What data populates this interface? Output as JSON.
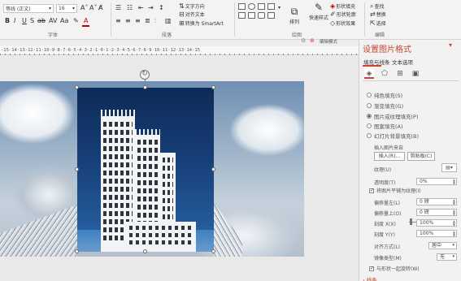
{
  "ribbon": {
    "font_name": "等线 (正文)",
    "font_size": "16",
    "group_labels": {
      "font": "字体",
      "paragraph": "段落",
      "drawing": "绘图",
      "editing": "编辑"
    },
    "text_direction": "文字方向",
    "align_text": "对齐文本",
    "convert_smartart": "转换为 SmartArt",
    "arrange": "排列",
    "quick_styles": "快速样式",
    "shape_fill": "形状填充",
    "shape_outline": "形状轮廓",
    "shape_effects": "形状效果",
    "find": "查找",
    "replace": "替换",
    "select": "选择",
    "editing_mode_label": "编辑模式"
  },
  "ruler": {
    "text": "-15·14·13·12·11·10·9·8·7·6·5·4·3·2·1·0·1·2·3·4·5·6·7·8·9·10·11·12·13·14·15"
  },
  "panel": {
    "title": "设置图片格式",
    "tab_fill_line": "填充与线条",
    "tab_text_box": "文本选项",
    "radio_options": [
      {
        "label": "纯色填充(S)",
        "checked": false
      },
      {
        "label": "渐变填充(G)",
        "checked": false
      },
      {
        "label": "图片或纹理填充(P)",
        "checked": true
      },
      {
        "label": "图案填充(A)",
        "checked": false
      },
      {
        "label": "幻灯片背景填充(B)",
        "checked": false
      }
    ],
    "insert_picture_from": "插入图片来自",
    "btn_file": "插入(R)...",
    "btn_clipboard": "剪贴板(C)",
    "texture_label": "纹理(U)",
    "transparency_label": "透明度(T)",
    "transparency_value": "0%",
    "tile_checkbox": "将图片平铺为纹理(I)",
    "offset_left_label": "偏移量左(L)",
    "offset_left_value": "0 磅",
    "offset_top_label": "偏移量上(O)",
    "offset_top_value": "0 磅",
    "scale_x_label": "刻度 X(X)",
    "scale_x_value": "100%",
    "scale_y_label": "刻度 Y(Y)",
    "scale_y_value": "100%",
    "alignment_label": "对齐方式(L)",
    "alignment_value": "居中",
    "mirror_label": "镜像类型(M)",
    "mirror_value": "无",
    "rotate_checkbox": "与形状一起旋转(W)",
    "line_section": "线条"
  },
  "colors": {
    "accent": "#c9452f",
    "photo_sky_top": "#0e2a56",
    "photo_sky_bottom": "#2a66a8",
    "building": "#f2f3f5"
  }
}
